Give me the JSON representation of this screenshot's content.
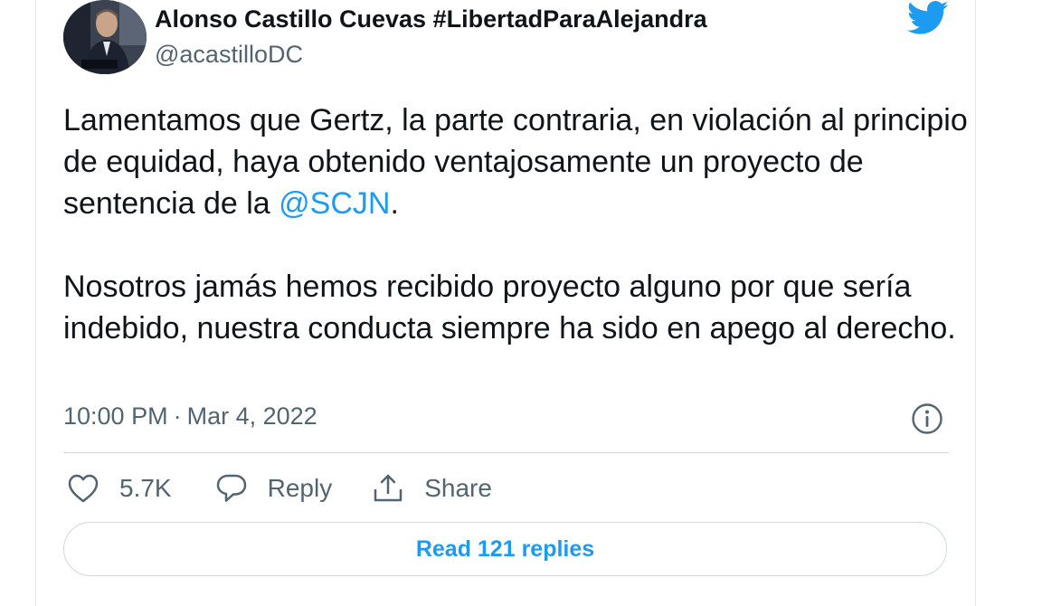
{
  "author": {
    "name": "Alonso Castillo Cuevas #LibertadParaAlejandra",
    "handle": "@acastilloDC"
  },
  "tweet": {
    "paragraph1_before": "Lamentamos que Gertz, la parte contraria, en violación al principio de equidad, haya obtenido ventajosamente un proyecto de sentencia de la ",
    "mention": "@SCJN",
    "paragraph1_after": ".",
    "paragraph2": "Nosotros jamás hemos recibido proyecto alguno por que sería indebido, nuestra conducta siempre ha sido en apego al derecho."
  },
  "meta": {
    "time": "10:00 PM",
    "separator": "·",
    "date": "Mar 4, 2022"
  },
  "actions": {
    "like_count": "5.7K",
    "reply_label": "Reply",
    "share_label": "Share"
  },
  "read_replies_label": "Read 121 replies",
  "colors": {
    "accent": "#1d9bf0",
    "text": "#0f1419",
    "muted": "#536471",
    "border": "#cfd9de"
  },
  "icons": {
    "brand": "twitter-bird-icon",
    "info": "info-icon",
    "like": "heart-icon",
    "reply": "speech-bubble-icon",
    "share": "share-icon"
  }
}
